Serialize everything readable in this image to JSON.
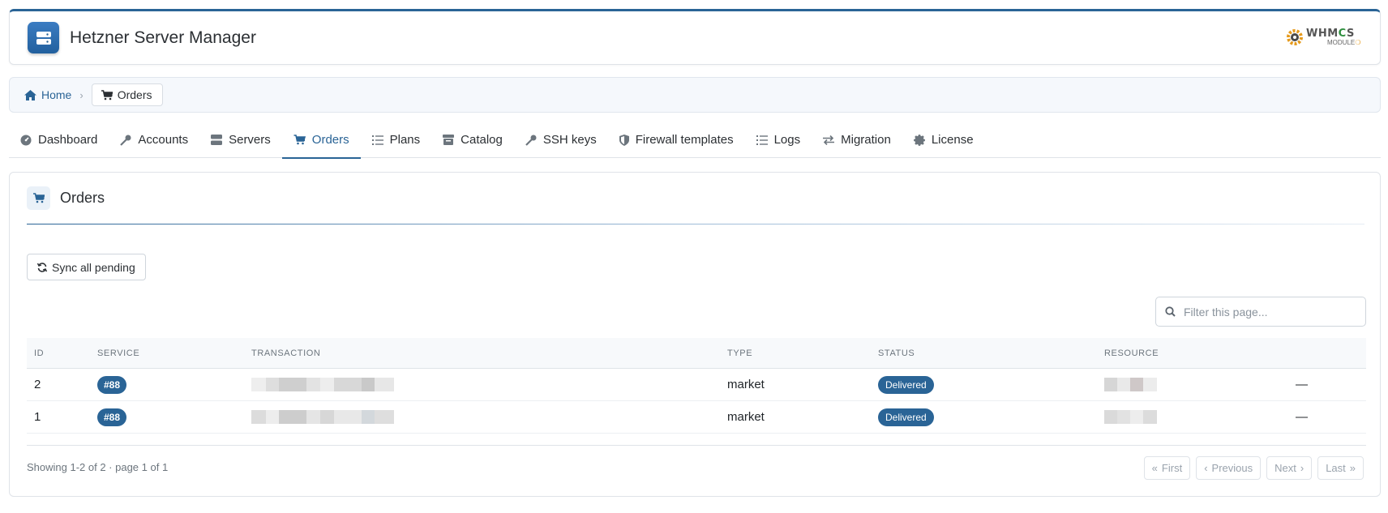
{
  "app": {
    "title": "Hetzner Server Manager"
  },
  "logo": {
    "line1_a": "WHM",
    "line1_c": "C",
    "line1_b": "S",
    "line2": "MODULE"
  },
  "breadcrumb": {
    "home": "Home",
    "current": "Orders"
  },
  "tabs": [
    {
      "label": "Dashboard",
      "icon": "gauge-icon"
    },
    {
      "label": "Accounts",
      "icon": "key-icon"
    },
    {
      "label": "Servers",
      "icon": "server-icon"
    },
    {
      "label": "Orders",
      "icon": "cart-icon",
      "active": true
    },
    {
      "label": "Plans",
      "icon": "list-icon"
    },
    {
      "label": "Catalog",
      "icon": "store-icon"
    },
    {
      "label": "SSH keys",
      "icon": "key-icon"
    },
    {
      "label": "Firewall templates",
      "icon": "shield-icon"
    },
    {
      "label": "Logs",
      "icon": "list-icon"
    },
    {
      "label": "Migration",
      "icon": "exchange-icon"
    },
    {
      "label": "License",
      "icon": "certificate-icon"
    }
  ],
  "card": {
    "title": "Orders"
  },
  "actions": {
    "sync_label": "Sync all pending"
  },
  "filter": {
    "placeholder": "Filter this page..."
  },
  "table": {
    "headers": [
      "ID",
      "SERVICE",
      "TRANSACTION",
      "TYPE",
      "STATUS",
      "RESOURCE"
    ],
    "rows": [
      {
        "id": "2",
        "service": "#88",
        "type": "market",
        "status": "Delivered",
        "dash": "—"
      },
      {
        "id": "1",
        "service": "#88",
        "type": "market",
        "status": "Delivered",
        "dash": "—"
      }
    ]
  },
  "footer": {
    "showing": "Showing 1-2 of 2 · page 1 of 1",
    "first": "First",
    "previous": "Previous",
    "next": "Next",
    "last": "Last"
  },
  "colors": {
    "accent": "#2a6496",
    "badge_bg": "#2a6496"
  }
}
